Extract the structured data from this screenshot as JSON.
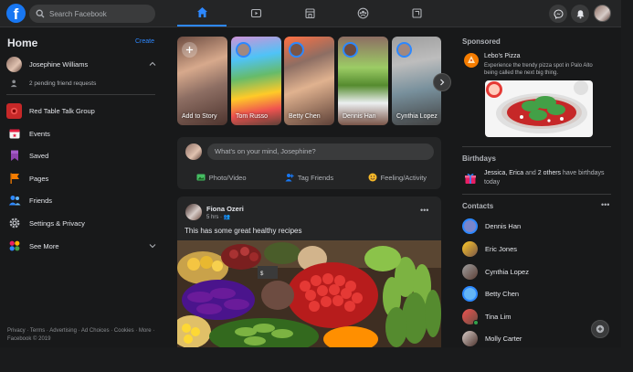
{
  "topbar": {
    "search_placeholder": "Search Facebook",
    "nav_tabs": [
      "home",
      "watch",
      "marketplace",
      "groups",
      "gaming"
    ],
    "active_tab": "home",
    "accent": "#2d88ff"
  },
  "left": {
    "title": "Home",
    "create_label": "Create",
    "profile_name": "Josephine Williams",
    "friend_requests": "2 pending friend requests",
    "items": [
      {
        "label": "Red Table Talk Group",
        "icon": "group-icon"
      },
      {
        "label": "Events",
        "icon": "calendar-icon"
      },
      {
        "label": "Saved",
        "icon": "bookmark-icon"
      },
      {
        "label": "Pages",
        "icon": "flag-icon"
      },
      {
        "label": "Friends",
        "icon": "friends-icon"
      },
      {
        "label": "Settings & Privacy",
        "icon": "gear-icon"
      },
      {
        "label": "See More",
        "icon": "see-more-icon"
      }
    ],
    "footer": "Privacy · Terms · Advertising · Ad Choices · Cookies · More · Facebook © 2019"
  },
  "stories": [
    {
      "name": "Add to Story"
    },
    {
      "name": "Tom Russo"
    },
    {
      "name": "Betty Chen"
    },
    {
      "name": "Dennis Han"
    },
    {
      "name": "Cynthia Lopez"
    }
  ],
  "composer": {
    "placeholder": "What's on your mind, Josephine?",
    "actions": [
      "Photo/Video",
      "Tag Friends",
      "Feeling/Activity"
    ]
  },
  "post": {
    "author": "Fiona Ozeri",
    "time": "5 hrs",
    "text": "This has some great healthy recipes"
  },
  "right": {
    "sponsored_title": "Sponsored",
    "ad_name": "Lebo's Pizza",
    "ad_desc": "Experience the trendy pizza spot in Palo Alto being called the next big thing.",
    "birthdays_title": "Birthdays",
    "birthday_names": "Jessica, Erica",
    "birthday_and": " and ",
    "birthday_others": "2 others",
    "birthday_rest": " have birthdays today",
    "contacts_title": "Contacts",
    "contacts": [
      {
        "name": "Dennis Han",
        "online": false
      },
      {
        "name": "Eric Jones",
        "online": false
      },
      {
        "name": "Cynthia Lopez",
        "online": false
      },
      {
        "name": "Betty Chen",
        "online": false
      },
      {
        "name": "Tina Lim",
        "online": true
      },
      {
        "name": "Molly Carter",
        "online": false
      }
    ]
  }
}
